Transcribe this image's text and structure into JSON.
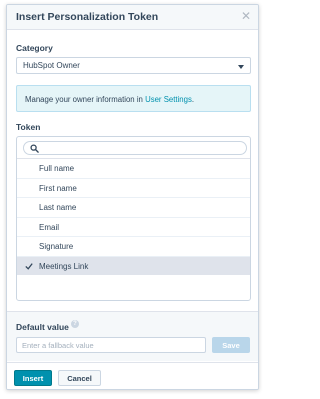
{
  "dialog": {
    "title": "Insert Personalization Token",
    "close_icon": "close-icon"
  },
  "category": {
    "label": "Category",
    "selected": "HubSpot Owner"
  },
  "info": {
    "text": "Manage your owner information in ",
    "link": "User Settings",
    "suffix": "."
  },
  "token": {
    "label": "Token",
    "search_value": "",
    "items": [
      {
        "label": "Full name",
        "selected": false
      },
      {
        "label": "First name",
        "selected": false
      },
      {
        "label": "Last name",
        "selected": false
      },
      {
        "label": "Email",
        "selected": false
      },
      {
        "label": "Signature",
        "selected": false
      },
      {
        "label": "Meetings Link",
        "selected": true
      }
    ]
  },
  "default_value": {
    "label": "Default value",
    "placeholder": "Enter a fallback value",
    "save_label": "Save"
  },
  "footer": {
    "insert_label": "Insert",
    "cancel_label": "Cancel"
  },
  "colors": {
    "accent": "#0091ae",
    "selected_row": "#dfe3eb",
    "info_bg": "#e5f5f8"
  }
}
